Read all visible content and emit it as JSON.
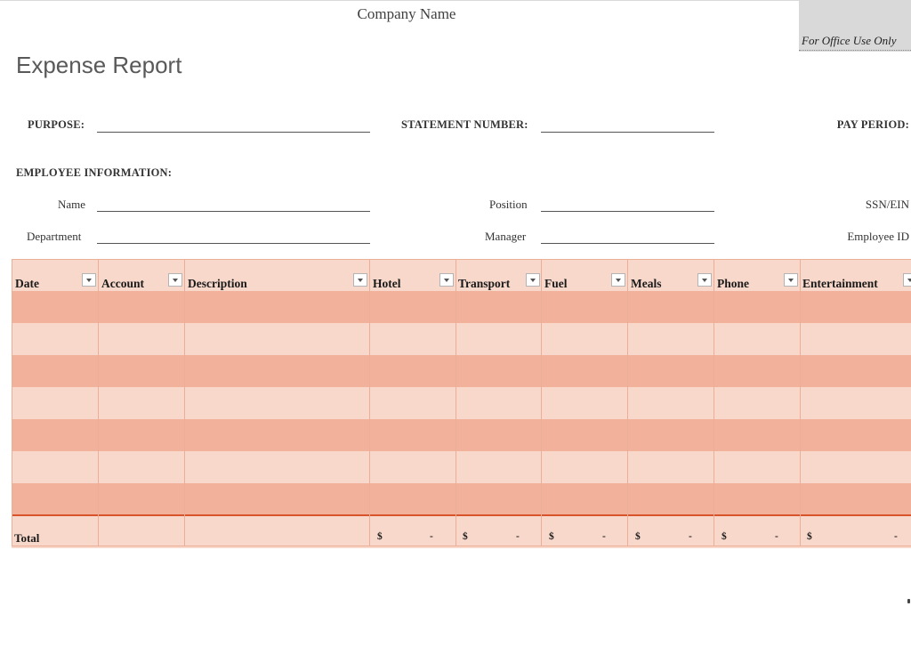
{
  "header": {
    "company_name": "Company Name",
    "office_use": "For Office Use Only",
    "title": "Expense Report"
  },
  "form": {
    "purpose_label": "PURPOSE:",
    "statement_label": "STATEMENT NUMBER:",
    "pay_period_label": "PAY PERIOD:",
    "employee_info_label": "EMPLOYEE INFORMATION:",
    "name_label": "Name",
    "position_label": "Position",
    "ssn_label": "SSN/EIN",
    "department_label": "Department",
    "manager_label": "Manager",
    "employee_id_label": "Employee ID"
  },
  "table": {
    "columns": [
      "Date",
      "Account",
      "Description",
      "Hotel",
      "Transport",
      "Fuel",
      "Meals",
      "Phone",
      "Entertainment"
    ],
    "row_count": 7,
    "total_label": "Total",
    "currency_symbol": "$",
    "total_value": "-"
  },
  "colors": {
    "header_fill": "#f8d8cb",
    "row_dark": "#f2b19a",
    "row_light": "#f8d8cb",
    "total_border": "#d9532a"
  }
}
